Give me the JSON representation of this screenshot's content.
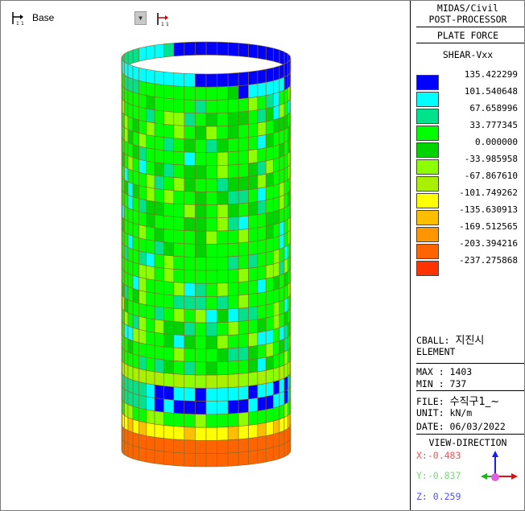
{
  "toolbar": {
    "stage_label": "Base"
  },
  "panel": {
    "app_title": "MIDAS/Civil",
    "app_subtitle": "POST-PROCESSOR",
    "result_type": "PLATE FORCE",
    "component": "SHEAR-Vxx",
    "legend": [
      {
        "value": "135.422299",
        "color": "#0000ff"
      },
      {
        "value": "101.540648",
        "color": "#00ffff"
      },
      {
        "value": "67.658996",
        "color": "#00e38c"
      },
      {
        "value": "33.777345",
        "color": "#00ff00"
      },
      {
        "value": "0.000000",
        "color": "#00d400"
      },
      {
        "value": "-33.985958",
        "color": "#8cff00"
      },
      {
        "value": "-67.867610",
        "color": "#a8f000"
      },
      {
        "value": "-101.749262",
        "color": "#ffff00"
      },
      {
        "value": "-135.630913",
        "color": "#ffbe00"
      },
      {
        "value": "-169.512565",
        "color": "#ff9600"
      },
      {
        "value": "-203.394216",
        "color": "#ff6400"
      },
      {
        "value": "-237.275868",
        "color": "#ff3200"
      }
    ],
    "load_case_prefix": "CBALL:",
    "load_case_name": "지진시",
    "element_label": "ELEMENT",
    "max_line": "MAX : 1403",
    "min_line": "MIN : 737",
    "file_prefix": "FILE:",
    "file_name": "수직구1_~",
    "unit_line": "UNIT: kN/m",
    "date_line": "DATE: 06/03/2022",
    "view_direction_title": "VIEW-DIRECTION",
    "view_x": "X:-0.483",
    "view_y": "Y:-0.837",
    "view_z": "Z: 0.259",
    "view_x_color": "#ff5050",
    "view_y_color": "#78d878",
    "view_z_color": "#5050ff"
  }
}
